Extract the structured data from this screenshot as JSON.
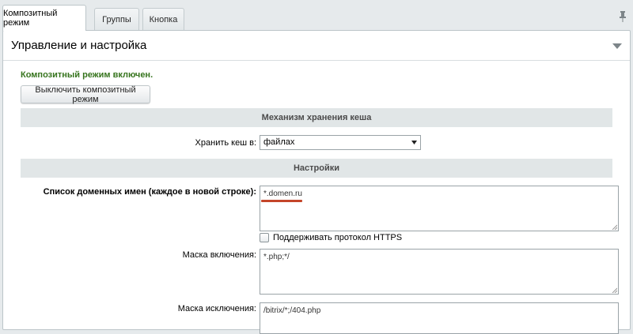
{
  "tabs": [
    {
      "label": "Композитный режим",
      "active": true
    },
    {
      "label": "Группы",
      "active": false
    },
    {
      "label": "Кнопка",
      "active": false
    }
  ],
  "panel": {
    "title": "Управление и настройка"
  },
  "status": {
    "text": "Композитный режим включен.",
    "color": "#36741d"
  },
  "disable_button": {
    "label": "Выключить композитный режим"
  },
  "cache_section": {
    "title": "Механизм хранения кеша"
  },
  "cache_store": {
    "label": "Хранить кеш в:",
    "selected": "файлах"
  },
  "settings_section": {
    "title": "Настройки"
  },
  "domains": {
    "label": "Список доменных имен (каждое в новой строке):",
    "value": "*.domen.ru",
    "highlight_color": "#c4452a"
  },
  "https": {
    "label": "Поддерживать протокол HTTPS",
    "checked": false
  },
  "include_mask": {
    "label": "Маска включения:",
    "value": "*.php;*/"
  },
  "exclude_mask": {
    "label": "Маска исключения:",
    "value": "/bitrix/*;/404.php"
  }
}
